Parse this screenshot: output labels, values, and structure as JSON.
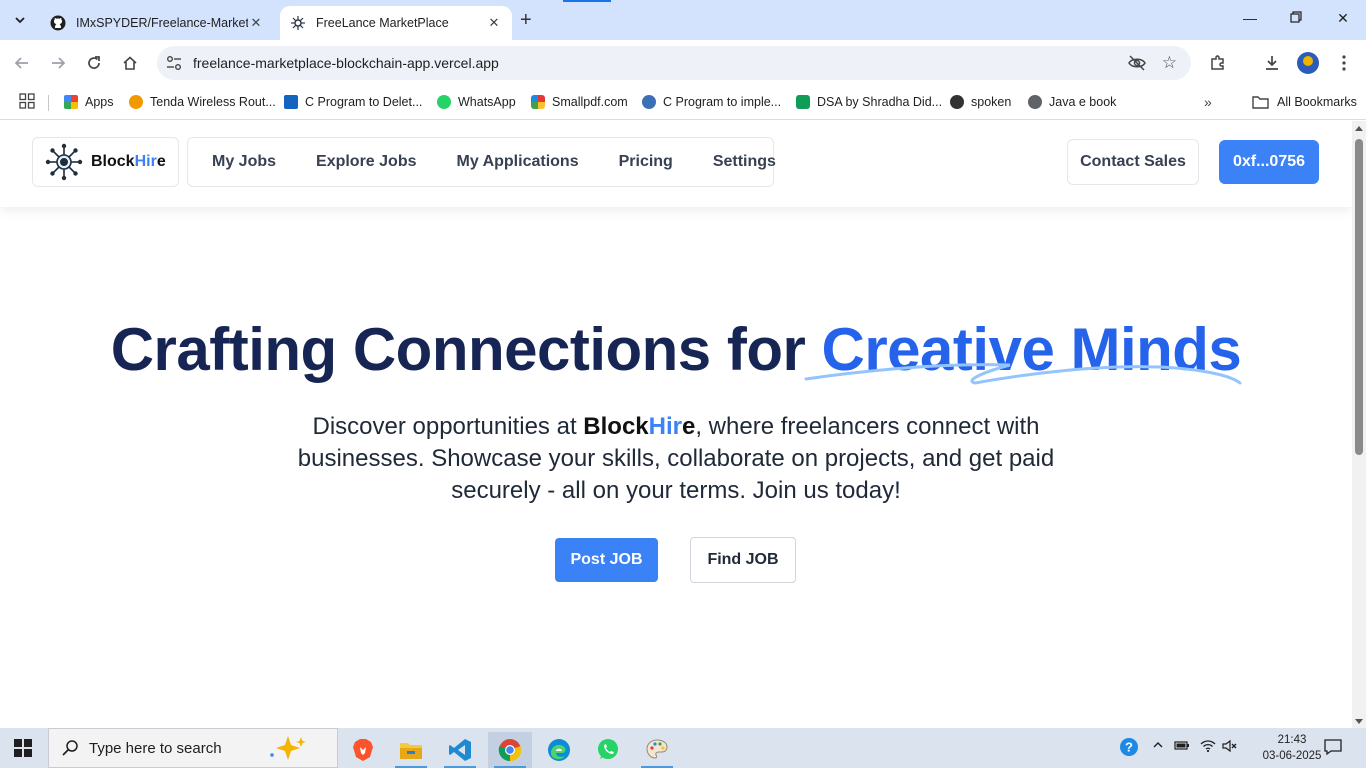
{
  "browser": {
    "tabs": [
      {
        "title": "IMxSPYDER/Freelance-Marketpl",
        "icon": "github-icon",
        "active": false
      },
      {
        "title": "FreeLance MarketPlace",
        "icon": "blockhire-logo-icon",
        "active": true
      }
    ],
    "url": "freelance-marketplace-blockchain-app.vercel.app",
    "bookmarks": [
      {
        "label": "Apps",
        "icon": "apps-grid-icon",
        "color": "#ea4335"
      },
      {
        "label": "Tenda Wireless Rout...",
        "icon": "tenda-icon",
        "color": "#f29900"
      },
      {
        "label": "C Program to Delet...",
        "icon": "w-icon",
        "color": "#1565c0"
      },
      {
        "label": "WhatsApp",
        "icon": "whatsapp-icon",
        "color": "#25d366"
      },
      {
        "label": "Smallpdf.com",
        "icon": "smallpdf-icon",
        "color": "#e53935"
      },
      {
        "label": "C Program to imple...",
        "icon": "wordpress-icon",
        "color": "#3b6fb6"
      },
      {
        "label": "DSA by Shradha Did...",
        "icon": "sheets-icon",
        "color": "#0f9d58"
      },
      {
        "label": "spoken",
        "icon": "spoken-icon",
        "color": "#333333"
      },
      {
        "label": "Java e book",
        "icon": "globe-icon",
        "color": "#5f6368"
      }
    ],
    "all_bookmarks": "All Bookmarks"
  },
  "site": {
    "brand_first": "Block",
    "brand_hi": "Hir",
    "brand_last": "e",
    "nav": [
      "My Jobs",
      "Explore Jobs",
      "My Applications",
      "Pricing",
      "Settings"
    ],
    "contact_label": "Contact Sales",
    "wallet_label": "0xf...0756",
    "hero_title_plain": "Crafting Connections for ",
    "hero_title_accent": "Creative Minds",
    "hero_desc_before": "Discover opportunities at ",
    "hero_desc_after": ", where freelancers connect with businesses. Showcase your skills, collaborate on projects, and get paid securely - all on your terms. Join us today!",
    "post_job_label": "Post JOB",
    "find_job_label": "Find JOB",
    "accent_color": "#3b82f6",
    "title_color": "#172554"
  },
  "taskbar": {
    "search_placeholder": "Type here to search",
    "apps": [
      "copilot-icon",
      "brave-icon",
      "file-explorer-icon",
      "vscode-icon",
      "chrome-icon",
      "edge-icon",
      "whatsapp-icon",
      "paint-icon"
    ],
    "time": "21:43",
    "date": "03-06-2025"
  }
}
